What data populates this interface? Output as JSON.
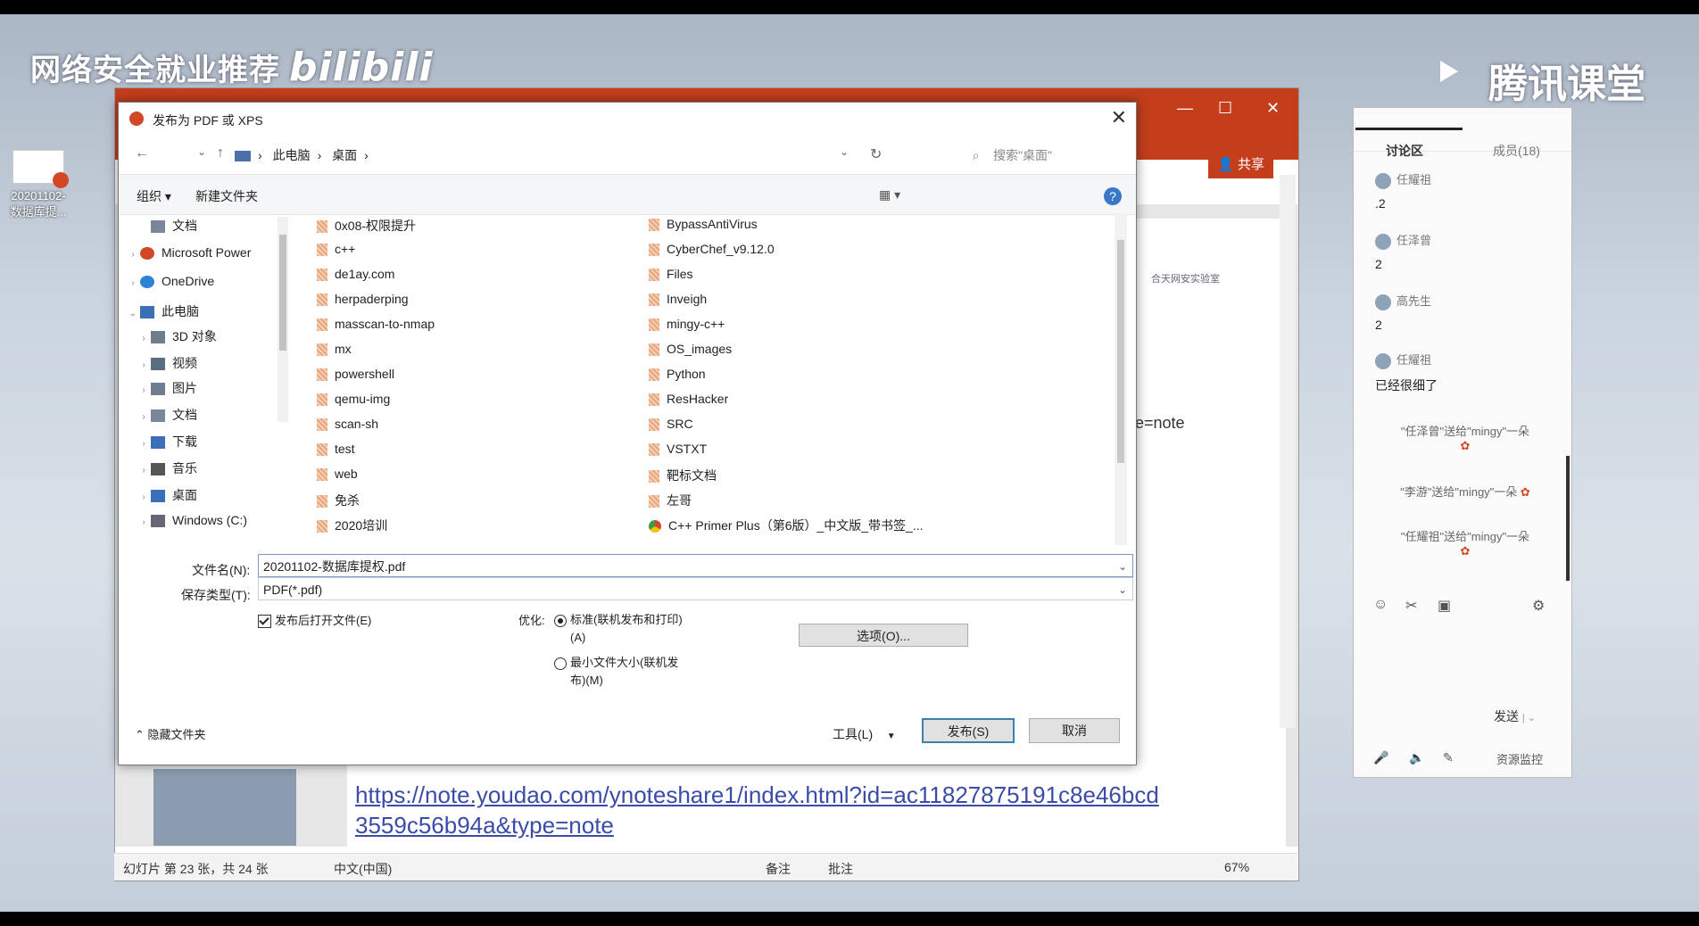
{
  "watermark": {
    "left": "网络安全就业推荐",
    "brand": "bilibili",
    "right": "腾讯课堂"
  },
  "desktop_icon": {
    "label": "20201102-数据库提..."
  },
  "ppt": {
    "window_controls": [
      "—",
      "☐",
      "✕"
    ],
    "share": "共享",
    "slide_link_line1": "https://note.youdao.com/ynoteshare1/index.html?id=ac11827875191c8e46bcd",
    "slide_link_line2": "3559c56b94a&type=note",
    "slide_fragment": "pe=note",
    "logo_text": "合天网安实验室",
    "status": {
      "slide_info": "幻灯片 第 23 张，共 24 张",
      "language": "中文(中国)",
      "notes": "备注",
      "comments": "批注",
      "zoom": "67%"
    }
  },
  "dialog": {
    "title": "发布为 PDF 或 XPS",
    "close": "✕",
    "breadcrumb": [
      "此电脑",
      "桌面"
    ],
    "search_placeholder": "搜索\"桌面\"",
    "toolbar": {
      "organize": "组织 ▾",
      "new_folder": "新建文件夹"
    },
    "tree": [
      {
        "label": "文档",
        "indent": 1
      },
      {
        "label": "Microsoft Power",
        "indent": 0
      },
      {
        "label": "OneDrive",
        "indent": 0
      },
      {
        "label": "此电脑",
        "indent": 0
      },
      {
        "label": "3D 对象",
        "indent": 1
      },
      {
        "label": "视频",
        "indent": 1
      },
      {
        "label": "图片",
        "indent": 1
      },
      {
        "label": "文档",
        "indent": 1
      },
      {
        "label": "下载",
        "indent": 1
      },
      {
        "label": "音乐",
        "indent": 1
      },
      {
        "label": "桌面",
        "indent": 1
      },
      {
        "label": "Windows (C:)",
        "indent": 1
      }
    ],
    "files_col1": [
      "0x08-权限提升",
      "c++",
      "de1ay.com",
      "herpaderping",
      "masscan-to-nmap",
      "mx",
      "powershell",
      "qemu-img",
      "scan-sh",
      "test",
      "web",
      "免杀",
      "2020培训"
    ],
    "files_col2": [
      "BypassAntiVirus",
      "CyberChef_v9.12.0",
      "Files",
      "Inveigh",
      "mingy-c++",
      "OS_images",
      "Python",
      "ResHacker",
      "SRC",
      "VSTXT",
      "靶标文档",
      "左哥",
      "C++ Primer Plus（第6版）_中文版_带书签_..."
    ],
    "filename_label": "文件名(N):",
    "filename_value": "20201102-数据库提权.pdf",
    "type_label": "保存类型(T):",
    "type_value": "PDF(*.pdf)",
    "open_after": "发布后打开文件(E)",
    "optimize_label": "优化:",
    "opt_standard_1": "标准(联机发布和打印)",
    "opt_standard_2": "(A)",
    "opt_min_1": "最小文件大小(联机发",
    "opt_min_2": "布)(M)",
    "options_button": "选项(O)...",
    "hide_folders": "隐藏文件夹",
    "tools": "工具(L)",
    "publish": "发布(S)",
    "cancel": "取消"
  },
  "chat": {
    "tab_discussion": "讨论区",
    "tab_members": "成员(18)",
    "messages": [
      {
        "name": "任耀祖",
        "text": ".2"
      },
      {
        "name": "任泽曾",
        "text": "2"
      },
      {
        "name": "高先生",
        "text": "2"
      },
      {
        "name": "任耀祖",
        "text": "已经很细了"
      }
    ],
    "gifts": [
      "\"任泽曾\"送给\"mingy\"一朵",
      "\"李游\"送给\"mingy\"一朵",
      "\"任耀祖\"送给\"mingy\"一朵"
    ],
    "send": "发送",
    "monitor": "资源监控"
  }
}
